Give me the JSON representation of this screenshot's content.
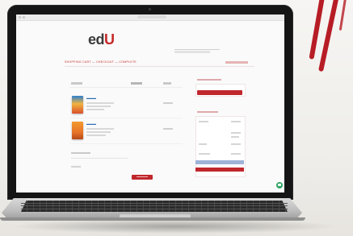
{
  "site": {
    "logo_text": "ed",
    "logo_accent": "U",
    "brand_color": "#c62828"
  },
  "checkout": {
    "breadcrumb": "SHOPPING CART — CHECKOUT — COMPLETE"
  },
  "colors": {
    "accent": "#c0272d",
    "secondary": "#9fb3d8",
    "chat": "#2fa463"
  },
  "icons": {
    "chat": "chat-icon"
  }
}
